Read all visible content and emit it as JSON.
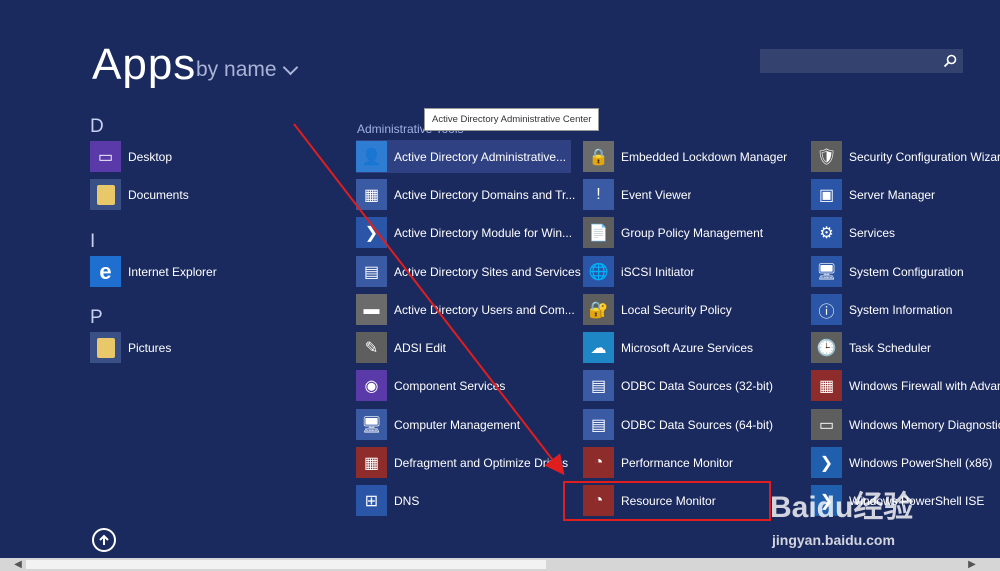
{
  "header": {
    "title": "Apps",
    "sort_label": "by name",
    "search_placeholder": ""
  },
  "groups": {
    "d": "D",
    "i": "I",
    "p": "P"
  },
  "left_apps": {
    "desktop": "Desktop",
    "documents": "Documents",
    "ie": "Internet Explorer",
    "pictures": "Pictures"
  },
  "category": "Administrative Tools",
  "tooltip": "Active Directory Administrative Center",
  "col1": [
    "Active Directory Administrative...",
    "Active Directory Domains and Tr...",
    "Active Directory Module for Win...",
    "Active Directory Sites and Services",
    "Active Directory Users and Com...",
    "ADSI Edit",
    "Component Services",
    "Computer Management",
    "Defragment and Optimize Drives",
    "DNS"
  ],
  "col2": [
    "Embedded Lockdown Manager",
    "Event Viewer",
    "Group Policy Management",
    "iSCSI Initiator",
    "Local Security Policy",
    "Microsoft Azure Services",
    "ODBC Data Sources (32-bit)",
    "ODBC Data Sources (64-bit)",
    "Performance Monitor",
    "Resource Monitor"
  ],
  "col3": [
    "Security Configuration Wizard",
    "Server Manager",
    "Services",
    "System Configuration",
    "System Information",
    "Task Scheduler",
    "Windows Firewall with Advanced Security",
    "Windows Memory Diagnostic",
    "Windows PowerShell (x86)",
    "Windows PowerShell ISE"
  ],
  "watermark": {
    "main": "Baidu经验",
    "sub": "jingyan.baidu.com"
  },
  "colors": {
    "background": "#1b2a5e",
    "selected_tile": "#2f4183",
    "highlight": "#e01e1e"
  }
}
